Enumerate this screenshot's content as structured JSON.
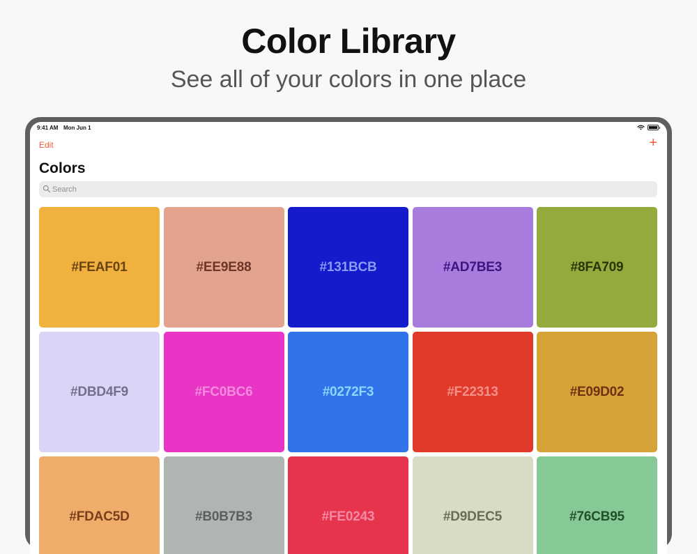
{
  "header": {
    "title": "Color Library",
    "subtitle": "See all of your colors in one place"
  },
  "status_bar": {
    "time": "9:41 AM",
    "date": "Mon Jun 1",
    "wifi_icon": "wifi-icon",
    "battery_icon": "battery-icon"
  },
  "nav": {
    "edit_label": "Edit",
    "add_label": "+"
  },
  "page": {
    "title": "Colors"
  },
  "search": {
    "placeholder": "Search",
    "icon": "search-icon"
  },
  "colors": [
    {
      "label": "#FEAF01",
      "fill": "#F1B13E",
      "text": "#6B4212"
    },
    {
      "label": "#EE9E88",
      "fill": "#E2A48F",
      "text": "#6D3526"
    },
    {
      "label": "#131BCB",
      "fill": "#131BCB",
      "text": "#8A9AF7"
    },
    {
      "label": "#AD7BE3",
      "fill": "#A77CDC",
      "text": "#3F1480"
    },
    {
      "label": "#8FA709",
      "fill": "#95AA3D",
      "text": "#2A3506"
    },
    {
      "label": "#DBD4F9",
      "fill": "#DBD4F6",
      "text": "#736D8E"
    },
    {
      "label": "#FC0BC6",
      "fill": "#E835C5",
      "text": "#F58ADF"
    },
    {
      "label": "#0272F3",
      "fill": "#3174EA",
      "text": "#88D8FF"
    },
    {
      "label": "#F22313",
      "fill": "#E13A2A",
      "text": "#F49089"
    },
    {
      "label": "#E09D02",
      "fill": "#D7A238",
      "text": "#6E3212"
    },
    {
      "label": "#FDAC5D",
      "fill": "#F0AC6B",
      "text": "#7A3E19"
    },
    {
      "label": "#B0B7B3",
      "fill": "#B0B5B1",
      "text": "#595F5B"
    },
    {
      "label": "#FE0243",
      "fill": "#E7344D",
      "text": "#F48BA6"
    },
    {
      "label": "#D9DEC5",
      "fill": "#D8DCC7",
      "text": "#676D56"
    },
    {
      "label": "#76CB95",
      "fill": "#86C996",
      "text": "#224F2C"
    }
  ]
}
